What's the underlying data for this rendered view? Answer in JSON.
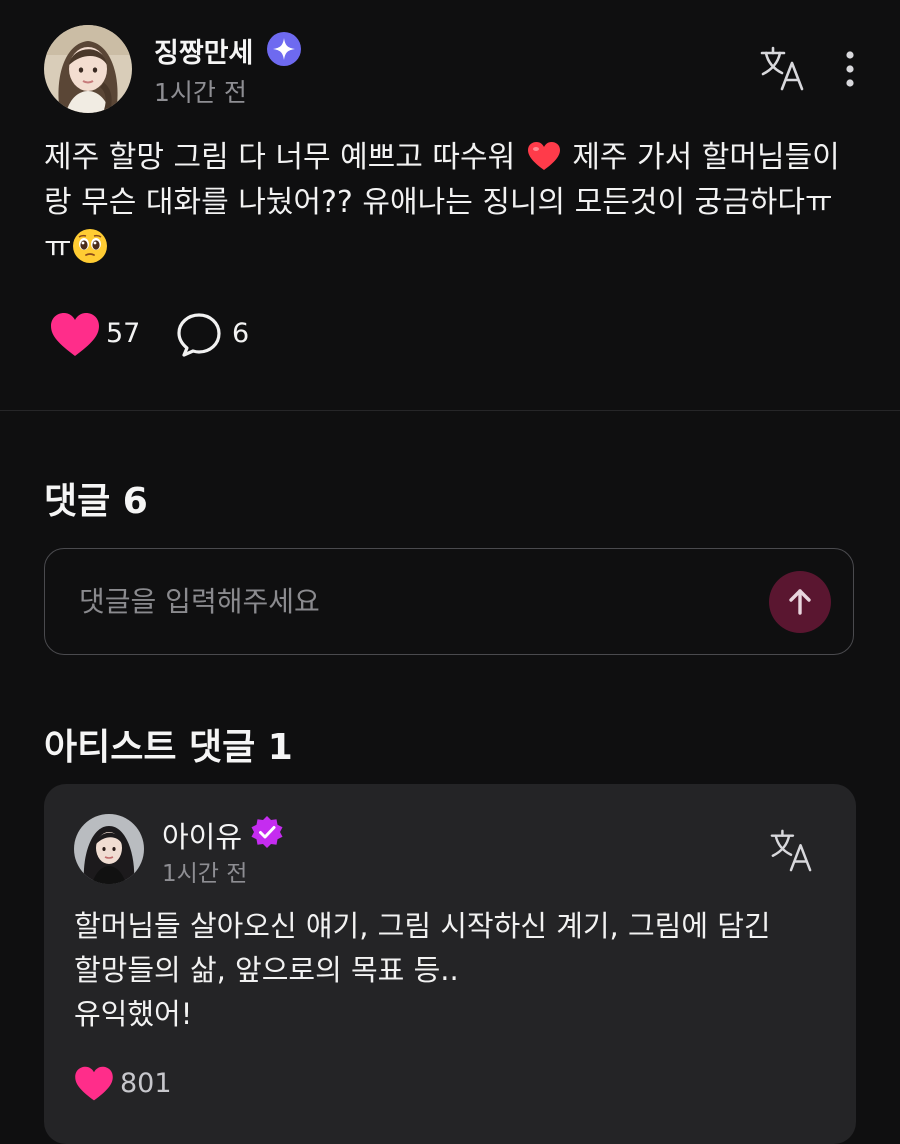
{
  "post": {
    "author": "징짱만세",
    "time": "1시간 전",
    "text_line1_a": "제주 할망 그림 다 너무 예쁘고 따수워",
    "text_line1_b": "제주 가서 할머님들이",
    "text_line2": "랑 무슨 대화를 나눴어?? 유애나는 징니의 모든것이 궁금하다ㅠ",
    "text_line3": "ㅠ",
    "likes": "57",
    "comments": "6"
  },
  "comments_section": {
    "heading": "댓글 6",
    "input_placeholder": "댓글을 입력해주세요"
  },
  "artist_section": {
    "heading": "아티스트 댓글 1",
    "comment": {
      "author": "아이유",
      "time": "1시간 전",
      "lines": [
        "할머님들 살아오신 얘기, 그림 시작하신 계기, 그림에 담긴",
        "할망들의 삶, 앞으로의 목표 등..",
        "유익했어!"
      ],
      "likes": "801"
    }
  },
  "icons": {
    "verified": "sparkle-verified-icon",
    "artist_badge": "artist-check-badge-icon",
    "translate": "translate-icon",
    "more": "more-vertical-icon",
    "like": "heart-icon",
    "comment": "speech-bubble-icon",
    "send": "arrow-up-icon",
    "inline_heart": "red-heart-emoji",
    "inline_emoji": "pleading-face-emoji"
  },
  "colors": {
    "background": "#0f0f10",
    "card": "#242426",
    "heart": "#ff2d8a",
    "verified": "#6e6af0",
    "artist_badge": "#c52cf0",
    "send_button": "#5a1630",
    "muted_text": "#8e8e93"
  }
}
